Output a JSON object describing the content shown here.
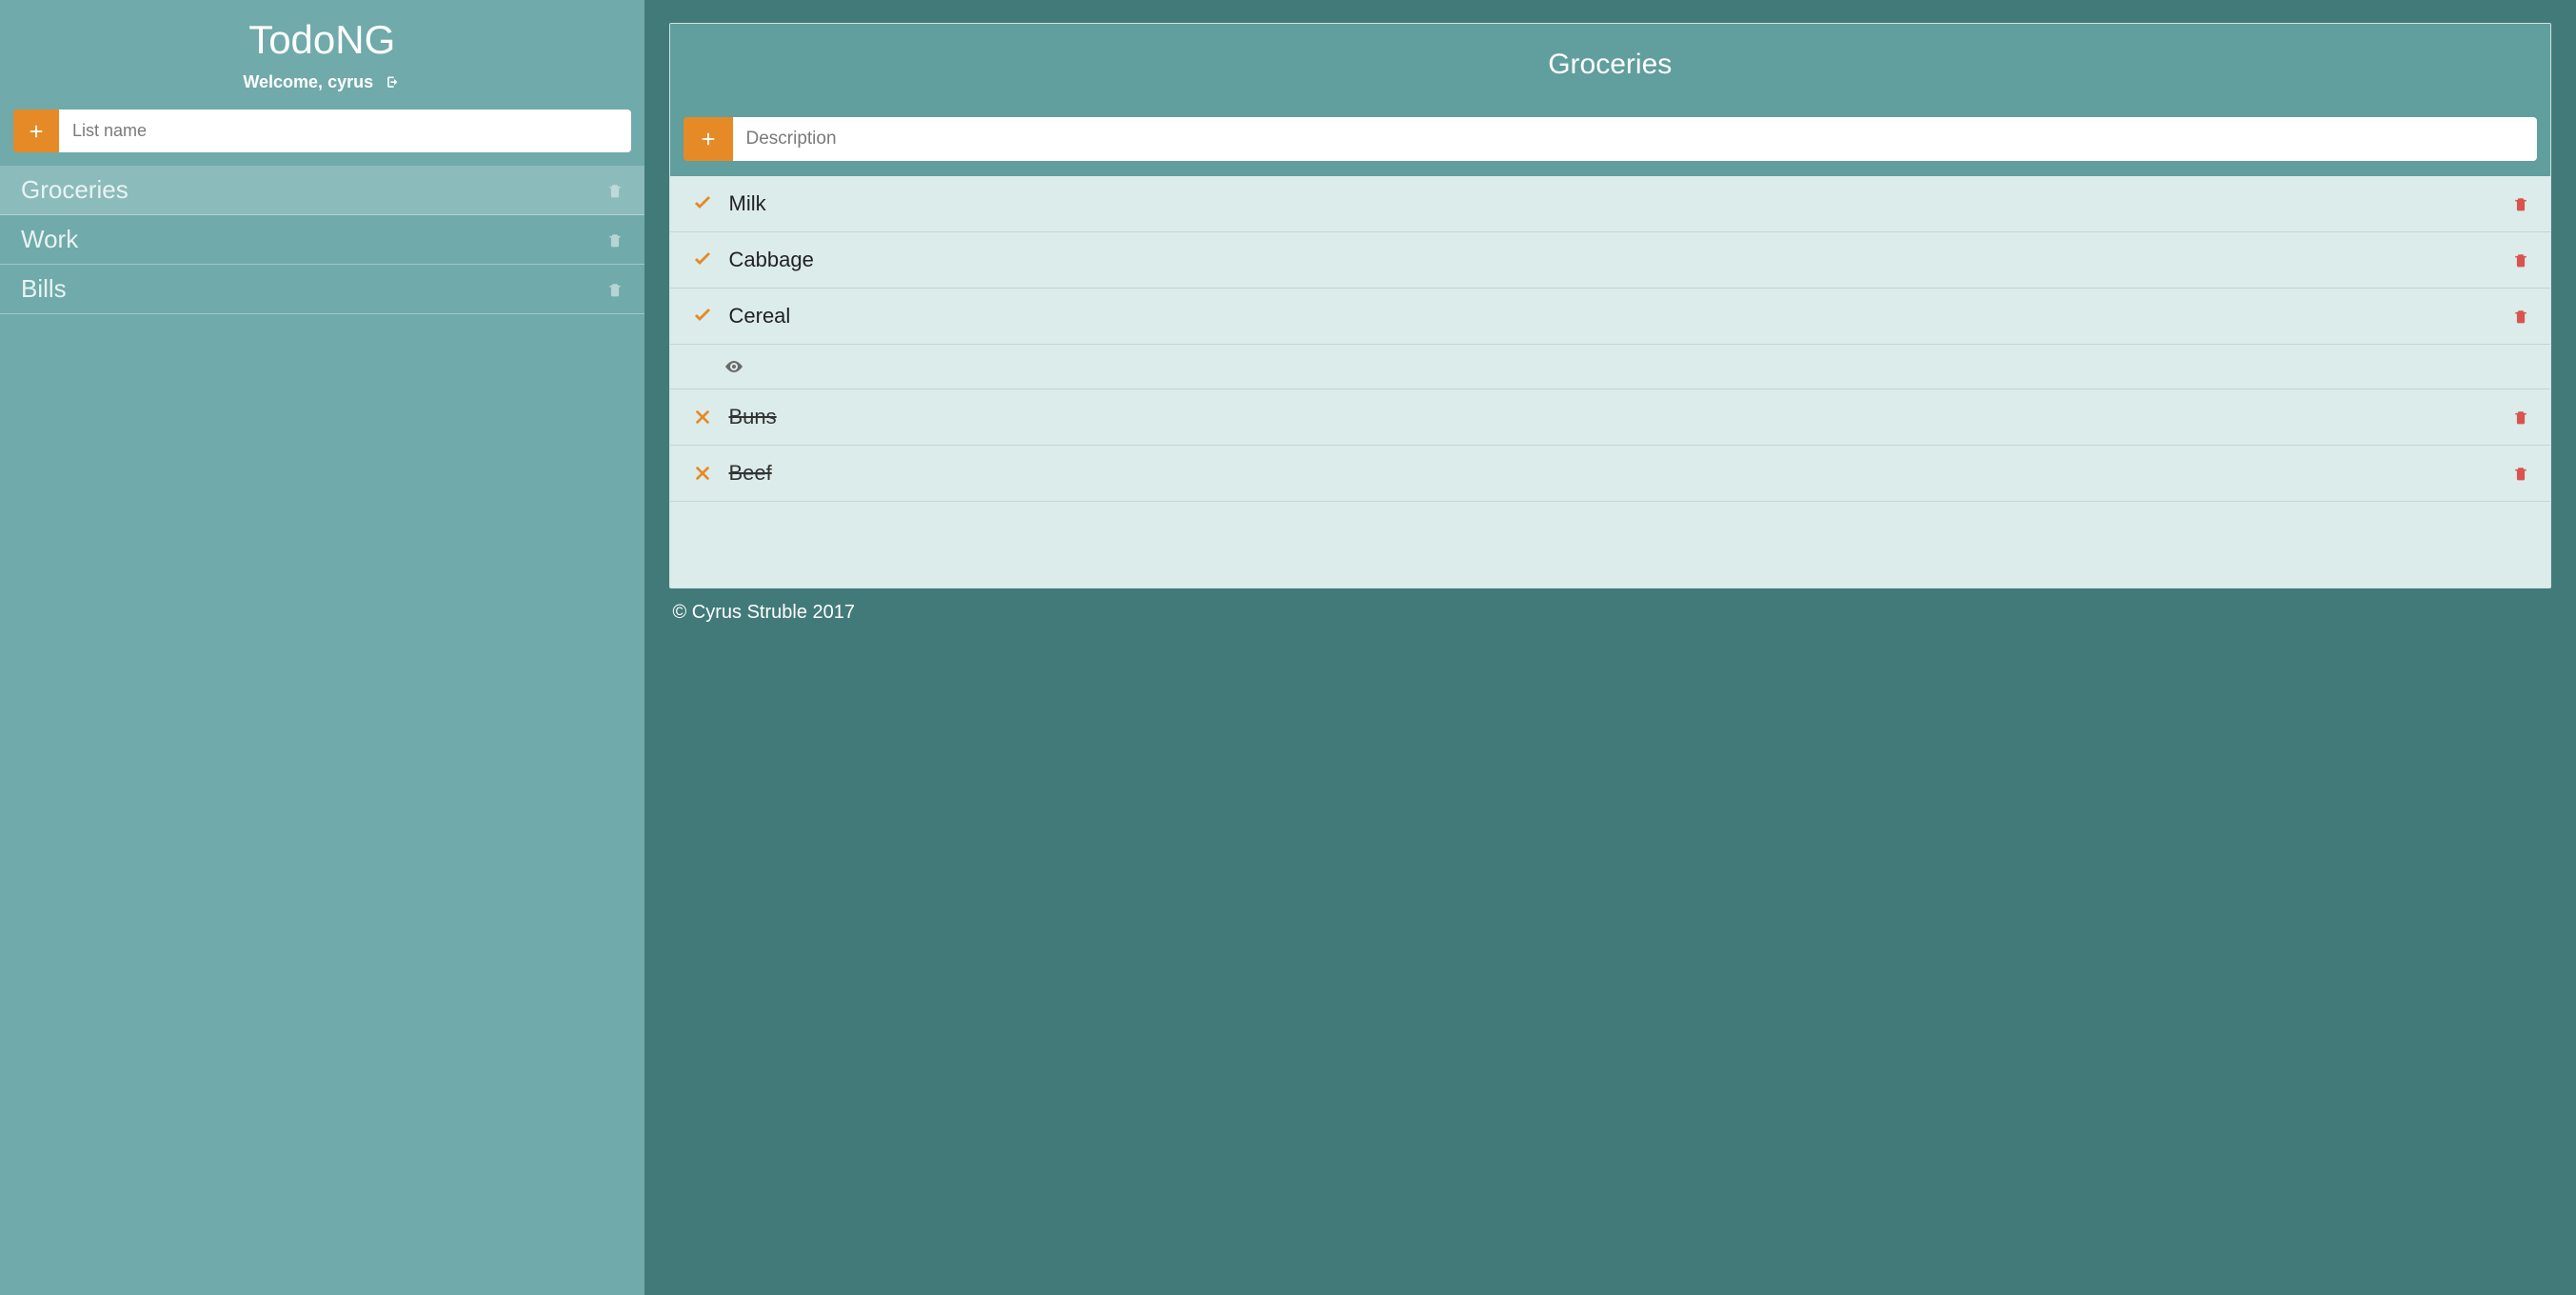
{
  "app": {
    "title": "TodoNG",
    "welcome_prefix": "Welcome, ",
    "username": "cyrus"
  },
  "sidebar": {
    "new_list_placeholder": "List name",
    "lists": [
      {
        "name": "Groceries",
        "active": true
      },
      {
        "name": "Work",
        "active": false
      },
      {
        "name": "Bills",
        "active": false
      }
    ]
  },
  "main": {
    "current_list_title": "Groceries",
    "new_item_placeholder": "Description",
    "items": [
      {
        "label": "Milk",
        "status": "open",
        "completed": false
      },
      {
        "label": "Cabbage",
        "status": "open",
        "completed": false
      },
      {
        "label": "Cereal",
        "status": "open",
        "completed": false
      },
      {
        "label": "Buns",
        "status": "done",
        "completed": true
      },
      {
        "label": "Beef",
        "status": "done",
        "completed": true
      }
    ]
  },
  "footer": {
    "copyright": "© Cyrus Struble 2017"
  },
  "colors": {
    "accent": "#e58a26",
    "danger": "#d9534f",
    "sidebar_bg": "#70aaaa",
    "panel_header_bg": "#619e9e",
    "panel_body_bg": "#dbecea",
    "page_bg": "#427a7a"
  },
  "icons": {
    "plus": "plus-icon",
    "logout": "sign-out-icon",
    "trash": "trash-icon",
    "check": "check-icon",
    "x": "x-icon",
    "eye": "eye-icon"
  }
}
